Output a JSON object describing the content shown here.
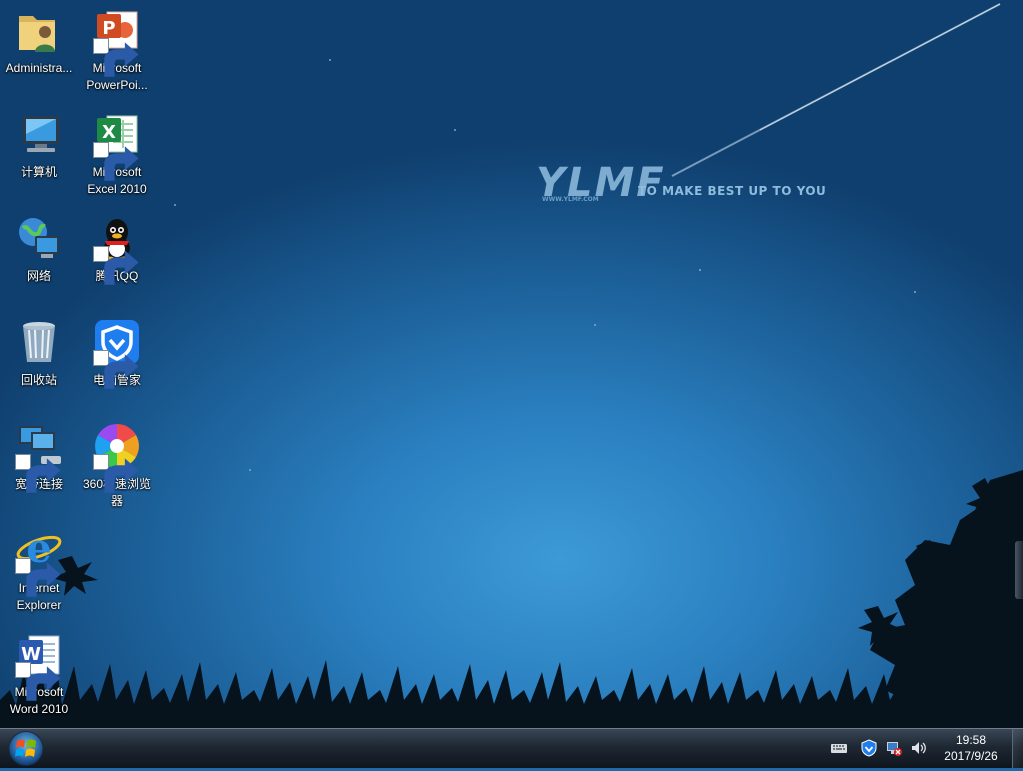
{
  "desktop": {
    "brand": {
      "logo": "YLMF",
      "tagline": "TO MAKE BEST UP TO YOU",
      "url": "WWW.YLMF.COM"
    },
    "icons": [
      {
        "label": "Administra...",
        "icon": "user-folder-icon"
      },
      {
        "label": "Microsoft PowerPoi...",
        "icon": "powerpoint-icon"
      },
      {
        "label": "计算机",
        "icon": "computer-icon"
      },
      {
        "label": "Microsoft Excel 2010",
        "icon": "excel-icon"
      },
      {
        "label": "网络",
        "icon": "network-icon"
      },
      {
        "label": "腾讯QQ",
        "icon": "qq-penguin-icon"
      },
      {
        "label": "回收站",
        "icon": "recycle-bin-icon"
      },
      {
        "label": "电脑管家",
        "icon": "pc-manager-shield-icon"
      },
      {
        "label": "宽带连接",
        "icon": "broadband-connection-icon"
      },
      {
        "label": "360极速浏览器",
        "icon": "360-browser-icon"
      },
      {
        "label": "Internet Explorer",
        "icon": "internet-explorer-icon"
      },
      {
        "label": "Microsoft Word 2010",
        "icon": "word-icon"
      }
    ]
  },
  "taskbar": {
    "clock": {
      "time": "19:58",
      "date": "2017/9/26"
    },
    "tray": [
      "keyboard-icon",
      "security-shield-icon",
      "network-status-icon",
      "volume-icon"
    ]
  },
  "colors": {
    "wallpaper_center": "#3d9ad6",
    "wallpaper_edge": "#0f3f6e",
    "taskbar": "#1e2833"
  }
}
